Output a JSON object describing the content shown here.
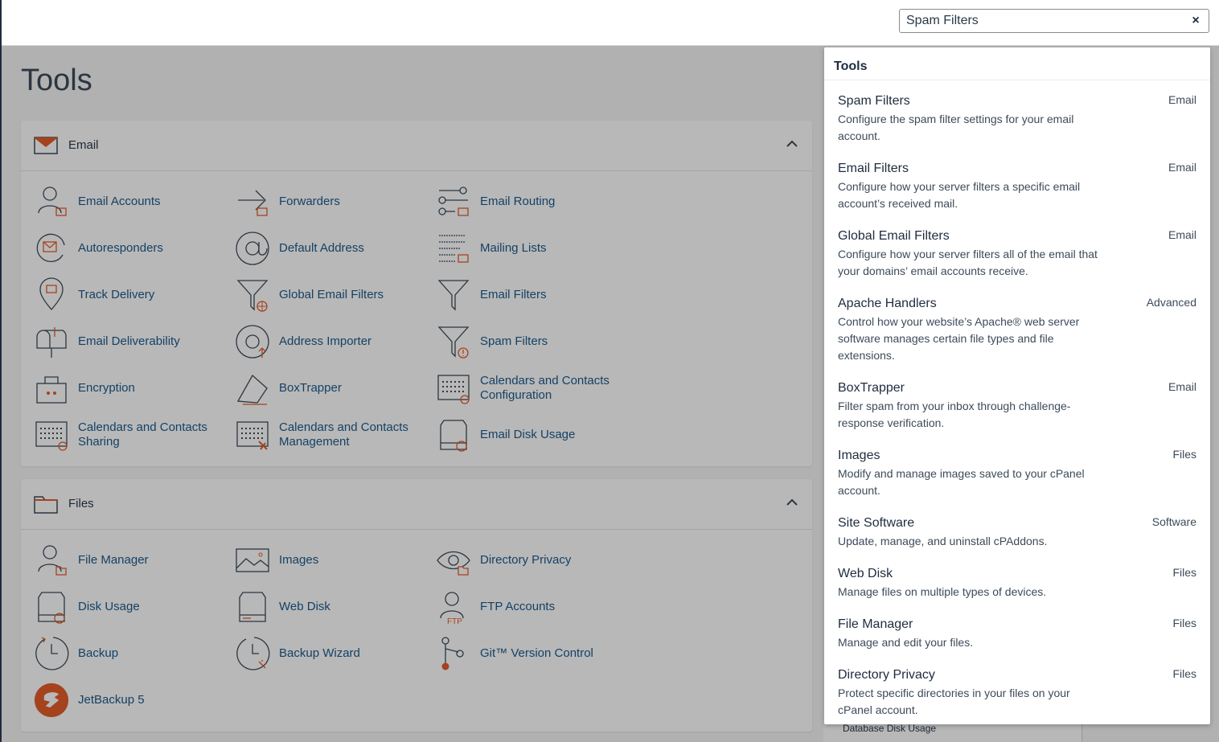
{
  "search": {
    "value": "Spam Filters",
    "clear_icon": "×"
  },
  "page_title": "Tools",
  "sections": [
    {
      "title": "Email",
      "items": [
        "Email Accounts",
        "Forwarders",
        "Email Routing",
        "Autoresponders",
        "Default Address",
        "Mailing Lists",
        "Track Delivery",
        "Global Email Filters",
        "Email Filters",
        "Email Deliverability",
        "Address Importer",
        "Spam Filters",
        "Encryption",
        "BoxTrapper",
        "Calendars and Contacts Configuration",
        "Calendars and Contacts Sharing",
        "Calendars and Contacts Management",
        "Email Disk Usage"
      ]
    },
    {
      "title": "Files",
      "items": [
        "File Manager",
        "Images",
        "Directory Privacy",
        "Disk Usage",
        "Web Disk",
        "FTP Accounts",
        "Backup",
        "Backup Wizard",
        "Git™ Version Control",
        "JetBackup 5"
      ]
    }
  ],
  "dropdown": {
    "heading": "Tools",
    "results": [
      {
        "title": "Spam Filters",
        "desc": "Configure the spam filter settings for your email account.",
        "category": "Email"
      },
      {
        "title": "Email Filters",
        "desc": "Configure how your server filters a specific email account’s received mail.",
        "category": "Email"
      },
      {
        "title": "Global Email Filters",
        "desc": "Configure how your server filters all of the email that your domains’ email accounts receive.",
        "category": "Email"
      },
      {
        "title": "Apache Handlers",
        "desc": "Control how your website’s Apache® web server software manages certain file types and file extensions.",
        "category": "Advanced"
      },
      {
        "title": "BoxTrapper",
        "desc": "Filter spam from your inbox through challenge-response verification.",
        "category": "Email"
      },
      {
        "title": "Images",
        "desc": "Modify and manage images saved to your cPanel account.",
        "category": "Files"
      },
      {
        "title": "Site Software",
        "desc": "Update, manage, and uninstall cPAddons.",
        "category": "Software"
      },
      {
        "title": "Web Disk",
        "desc": "Manage files on multiple types of devices.",
        "category": "Files"
      },
      {
        "title": "File Manager",
        "desc": "Manage and edit your files.",
        "category": "Files"
      },
      {
        "title": "Directory Privacy",
        "desc": "Protect specific directories in your files on your cPanel account.",
        "category": "Files"
      }
    ]
  },
  "behind_item": "Database Disk Usage",
  "colors": {
    "accent": "#e35d29",
    "link": "#1c5a8c",
    "nav_dark": "#1f2c3f"
  }
}
